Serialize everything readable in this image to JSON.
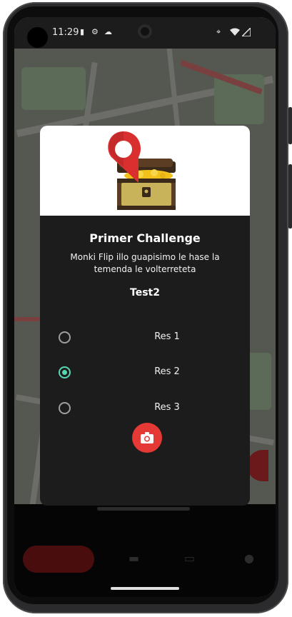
{
  "status_bar": {
    "time": "11:29",
    "icons": [
      "sim-icon",
      "settings-icon",
      "cloud-icon",
      "location-icon",
      "wifi-icon",
      "signal-icon"
    ]
  },
  "dialog": {
    "title": "Primer Challenge",
    "description": "Monki Flip illo guapisimo le hase la temenda le volterreteta",
    "question": "Test2",
    "options": [
      {
        "label": "Res 1",
        "selected": false
      },
      {
        "label": "Res 2",
        "selected": true
      },
      {
        "label": "Res 3",
        "selected": false
      }
    ],
    "camera_button_icon": "camera-icon"
  },
  "colors": {
    "accent_red": "#e53935",
    "radio_selected": "#57d6b3",
    "dialog_bg": "#1c1c1c"
  }
}
